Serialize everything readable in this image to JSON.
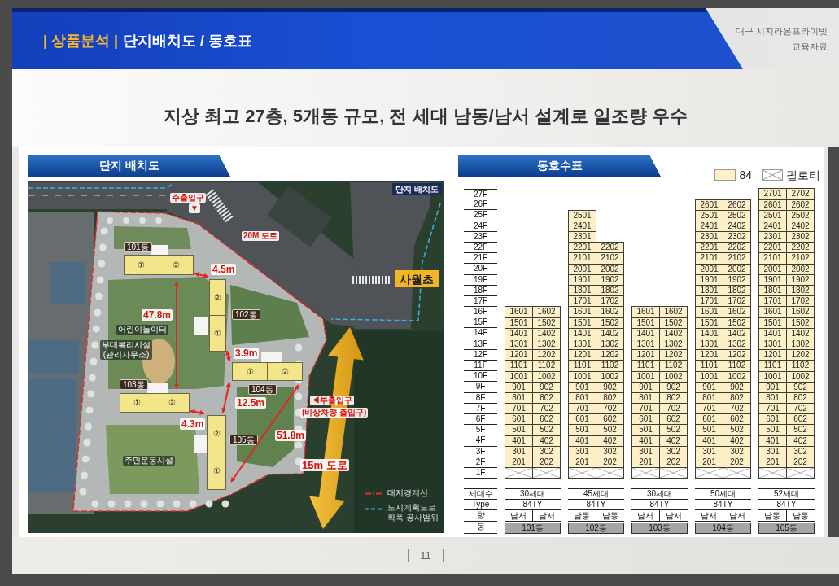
{
  "header": {
    "category": "| 상품분석 |",
    "title": "단지배치도 / 동호표",
    "company": "대구 시지라온프라이빗",
    "document_type": "교육자료"
  },
  "headline": "지상 최고 27층, 5개동 규모, 전 세대 남동/남서 설계로 일조량 우수",
  "site_plan": {
    "title": "단지 배치도",
    "map_tag": "단지 배치도",
    "school_label": "사월초",
    "road_label": "15m 도로",
    "buildings": [
      {
        "label": "101동",
        "units": [
          "①",
          "②"
        ]
      },
      {
        "label": "102동",
        "units": [
          "②",
          "①"
        ]
      },
      {
        "label": "103동",
        "units": [
          "①",
          "②"
        ]
      },
      {
        "label": "104동",
        "units": [
          "①",
          "②"
        ]
      },
      {
        "label": "105동",
        "units": [
          "②",
          "①"
        ]
      }
    ],
    "distances": [
      "4.5m",
      "47.8m",
      "3.9m",
      "12.5m",
      "4.3m",
      "51.8m"
    ],
    "places": [
      {
        "kind": "access",
        "text": "주출입구"
      },
      {
        "kind": "access",
        "text": "▼"
      },
      {
        "kind": "access",
        "text": "20M 도로"
      },
      {
        "kind": "facility",
        "text": "어린이놀이터"
      },
      {
        "kind": "facility",
        "text": "부대복리시설\n(관리사무소)"
      },
      {
        "kind": "facility",
        "text": "주민운동시설"
      },
      {
        "kind": "access",
        "text": "◀부출입구"
      },
      {
        "kind": "access",
        "text": "(비상차량 출입구)"
      }
    ],
    "legend": [
      {
        "kind": "boundary",
        "label": "대지경계선"
      },
      {
        "kind": "road_plan",
        "label": "도시계획도로\n확폭 공사범위"
      }
    ]
  },
  "unit_table": {
    "title": "동호수표",
    "legend": [
      {
        "kind": "unit",
        "label": "84"
      },
      {
        "kind": "piloti",
        "label": "필로티"
      }
    ],
    "floors": [
      "27F",
      "26F",
      "25F",
      "24F",
      "23F",
      "22F",
      "21F",
      "20F",
      "19F",
      "18F",
      "17F",
      "16F",
      "15F",
      "14F",
      "13F",
      "12F",
      "11F",
      "10F",
      "9F",
      "8F",
      "7F",
      "6F",
      "5F",
      "4F",
      "3F",
      "2F",
      "1F"
    ],
    "summary_labels": [
      "세대수",
      "Type",
      "향",
      "동"
    ],
    "buildings": [
      {
        "rows": [
          [
            "1601",
            "1602"
          ],
          [
            "1501",
            "1502"
          ],
          [
            "1401",
            "1402"
          ],
          [
            "1301",
            "1302"
          ],
          [
            "1201",
            "1202"
          ],
          [
            "1101",
            "1102"
          ],
          [
            "1001",
            "1002"
          ],
          [
            "901",
            "902"
          ],
          [
            "801",
            "802"
          ],
          [
            "701",
            "702"
          ],
          [
            "601",
            "602"
          ],
          [
            "501",
            "502"
          ],
          [
            "401",
            "402"
          ],
          [
            "301",
            "302"
          ],
          [
            "201",
            "202"
          ]
        ],
        "ground": [
          {
            "kind": "piloti"
          },
          {
            "kind": "piloti"
          }
        ],
        "households": "30세대",
        "type": "84TY",
        "directions": [
          "남서",
          "남서"
        ],
        "name": "101동"
      },
      {
        "rows": [
          [
            "2501"
          ],
          [
            "2401"
          ],
          [
            "2301"
          ],
          [
            "2201",
            "2202"
          ],
          [
            "2101",
            "2102"
          ],
          [
            "2001",
            "2002"
          ],
          [
            "1901",
            "1902"
          ],
          [
            "1801",
            "1802"
          ],
          [
            "1701",
            "1702"
          ],
          [
            "1601",
            "1602"
          ],
          [
            "1501",
            "1502"
          ],
          [
            "1401",
            "1402"
          ],
          [
            "1301",
            "1302"
          ],
          [
            "1201",
            "1202"
          ],
          [
            "1101",
            "1102"
          ],
          [
            "1001",
            "1002"
          ],
          [
            "901",
            "902"
          ],
          [
            "801",
            "802"
          ],
          [
            "701",
            "702"
          ],
          [
            "601",
            "602"
          ],
          [
            "501",
            "502"
          ],
          [
            "401",
            "402"
          ],
          [
            "301",
            "302"
          ],
          [
            "201",
            "202"
          ]
        ],
        "ground": [
          {
            "kind": "piloti"
          },
          {
            "kind": "piloti"
          }
        ],
        "households": "45세대",
        "type": "84TY",
        "directions": [
          "남동",
          "남동"
        ],
        "name": "102동"
      },
      {
        "rows": [
          [
            "1601",
            "1602"
          ],
          [
            "1501",
            "1502"
          ],
          [
            "1401",
            "1402"
          ],
          [
            "1301",
            "1302"
          ],
          [
            "1201",
            "1202"
          ],
          [
            "1101",
            "1102"
          ],
          [
            "1001",
            "1002"
          ],
          [
            "901",
            "902"
          ],
          [
            "801",
            "802"
          ],
          [
            "701",
            "702"
          ],
          [
            "601",
            "602"
          ],
          [
            "501",
            "502"
          ],
          [
            "401",
            "402"
          ],
          [
            "301",
            "302"
          ],
          [
            "201",
            "202"
          ]
        ],
        "ground": [
          {
            "kind": "piloti"
          },
          {
            "kind": "piloti"
          }
        ],
        "households": "30세대",
        "type": "84TY",
        "directions": [
          "남서",
          "남서"
        ],
        "name": "103동"
      },
      {
        "rows": [
          [
            "2601",
            "2602"
          ],
          [
            "2501",
            "2502"
          ],
          [
            "2401",
            "2402"
          ],
          [
            "2301",
            "2302"
          ],
          [
            "2201",
            "2202"
          ],
          [
            "2101",
            "2102"
          ],
          [
            "2001",
            "2002"
          ],
          [
            "1901",
            "1902"
          ],
          [
            "1801",
            "1802"
          ],
          [
            "1701",
            "1702"
          ],
          [
            "1601",
            "1602"
          ],
          [
            "1501",
            "1502"
          ],
          [
            "1401",
            "1402"
          ],
          [
            "1301",
            "1302"
          ],
          [
            "1201",
            "1202"
          ],
          [
            "1101",
            "1102"
          ],
          [
            "1001",
            "1002"
          ],
          [
            "901",
            "902"
          ],
          [
            "801",
            "802"
          ],
          [
            "701",
            "702"
          ],
          [
            "601",
            "602"
          ],
          [
            "501",
            "502"
          ],
          [
            "401",
            "402"
          ],
          [
            "301",
            "302"
          ],
          [
            "201",
            "202"
          ]
        ],
        "ground": [
          {
            "kind": "piloti"
          },
          {
            "kind": "piloti"
          }
        ],
        "households": "50세대",
        "type": "84TY",
        "directions": [
          "남서",
          "남서"
        ],
        "name": "104동"
      },
      {
        "rows": [
          [
            "2701",
            "2702"
          ],
          [
            "2601",
            "2602"
          ],
          [
            "2501",
            "2502"
          ],
          [
            "2401",
            "2402"
          ],
          [
            "2301",
            "2302"
          ],
          [
            "2201",
            "2202"
          ],
          [
            "2101",
            "2102"
          ],
          [
            "2001",
            "2002"
          ],
          [
            "1901",
            "1902"
          ],
          [
            "1801",
            "1802"
          ],
          [
            "1701",
            "1702"
          ],
          [
            "1601",
            "1602"
          ],
          [
            "1501",
            "1502"
          ],
          [
            "1401",
            "1402"
          ],
          [
            "1301",
            "1302"
          ],
          [
            "1201",
            "1202"
          ],
          [
            "1101",
            "1102"
          ],
          [
            "1001",
            "1002"
          ],
          [
            "901",
            "902"
          ],
          [
            "801",
            "802"
          ],
          [
            "701",
            "702"
          ],
          [
            "601",
            "602"
          ],
          [
            "501",
            "502"
          ],
          [
            "401",
            "402"
          ],
          [
            "301",
            "302"
          ],
          [
            "201",
            "202"
          ]
        ],
        "ground": [
          {
            "kind": "piloti"
          },
          {
            "kind": "piloti"
          }
        ],
        "households": "52세대",
        "type": "84TY",
        "directions": [
          "남동",
          "남동"
        ],
        "name": "105동"
      }
    ]
  },
  "footer": {
    "page": "11"
  }
}
